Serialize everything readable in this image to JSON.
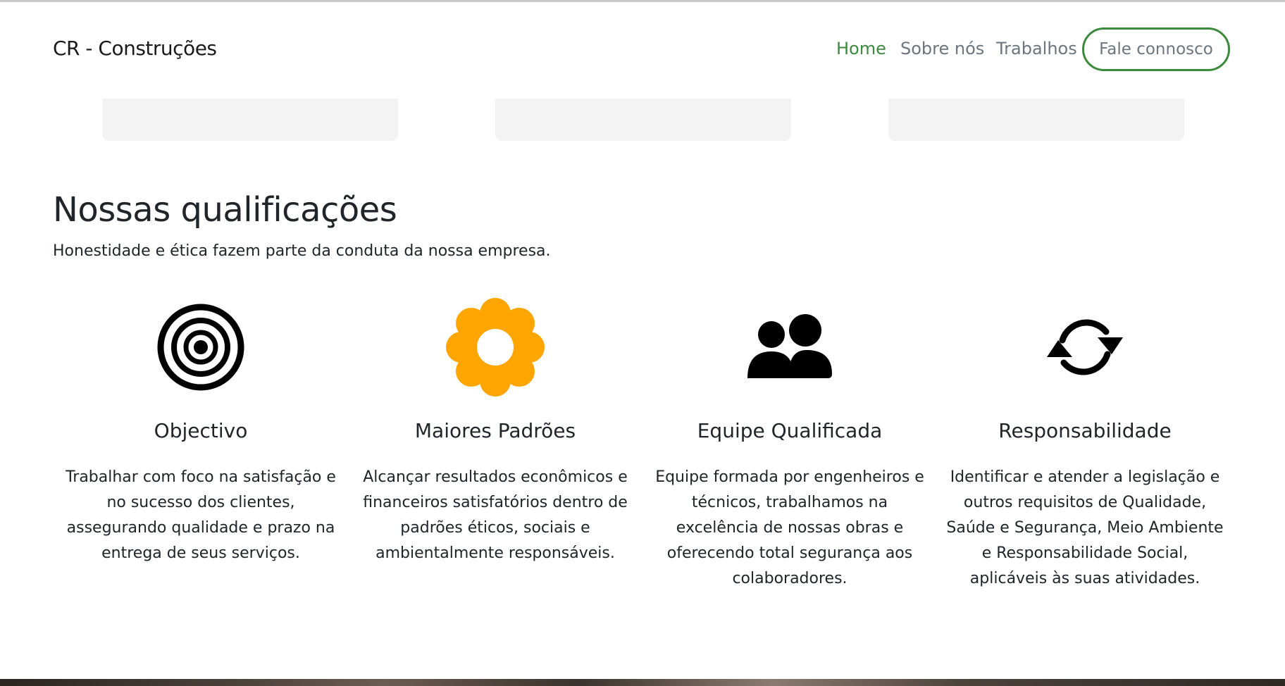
{
  "navbar": {
    "brand": "CR - Construções",
    "links": [
      {
        "label": "Home",
        "active": true
      },
      {
        "label": "Sobre nós",
        "active": false
      },
      {
        "label": "Trabalhos",
        "active": false
      }
    ],
    "contact_label": "Fale connosco"
  },
  "colors": {
    "accent_green": "#3c8a3c",
    "gear_orange": "#ffa500"
  },
  "qualifications": {
    "title": "Nossas qualificações",
    "subtitle": "Honestidade e ética fazem parte da conduta da nossa empresa.",
    "items": [
      {
        "icon": "target-icon",
        "title": "Objectivo",
        "text": "Trabalhar com foco na satisfação e no sucesso dos clientes, assegurando qualidade e prazo na entrega de seus serviços."
      },
      {
        "icon": "gear-icon",
        "title": "Maiores Padrões",
        "text": "Alcançar resultados econômicos e financeiros satisfatórios dentro de padrões éticos, sociais e ambientalmente responsáveis."
      },
      {
        "icon": "users-icon",
        "title": "Equipe Qualificada",
        "text": "Equipe formada por engenheiros e técnicos, trabalhamos na excelência de nossas obras e oferecendo total segurança aos colaboradores."
      },
      {
        "icon": "sync-icon",
        "title": "Responsabilidade",
        "text": "Identificar e atender a legislação e outros requisitos de Qualidade, Saúde e Segurança, Meio Ambiente e Responsabilidade Social, aplicáveis às suas atividades."
      }
    ]
  }
}
